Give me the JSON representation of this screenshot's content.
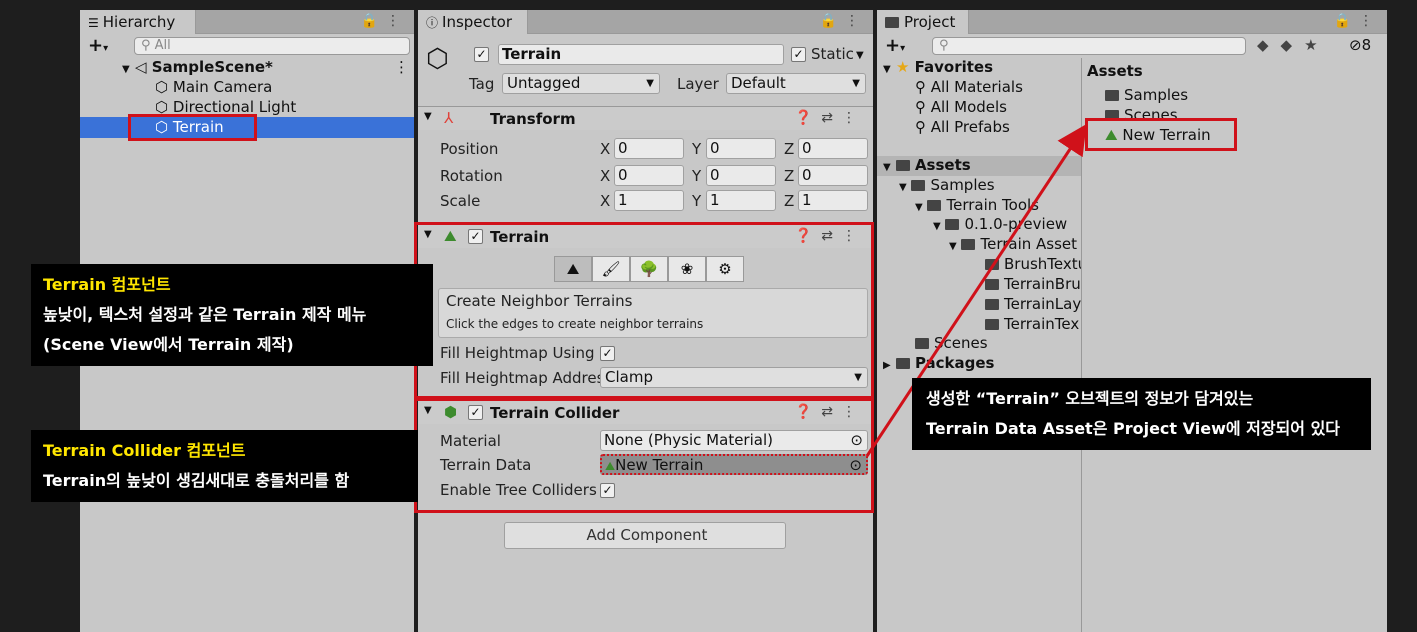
{
  "hierarchy": {
    "tab": "Hierarchy",
    "search_placeholder": "All",
    "scene": "SampleScene*",
    "items": [
      "Main Camera",
      "Directional Light",
      "Terrain"
    ]
  },
  "inspector": {
    "tab": "Inspector",
    "object_name": "Terrain",
    "static_label": "Static",
    "tag_label": "Tag",
    "tag_value": "Untagged",
    "layer_label": "Layer",
    "layer_value": "Default",
    "transform": {
      "title": "Transform",
      "position_label": "Position",
      "rotation_label": "Rotation",
      "scale_label": "Scale",
      "axis_x": "X",
      "axis_y": "Y",
      "axis_z": "Z",
      "position": [
        "0",
        "0",
        "0"
      ],
      "rotation": [
        "0",
        "0",
        "0"
      ],
      "scale": [
        "1",
        "1",
        "1"
      ]
    },
    "terrain": {
      "title": "Terrain",
      "neighbor_title": "Create Neighbor Terrains",
      "neighbor_desc": "Click the edges to create neighbor terrains",
      "fill_heightmap_using": "Fill Heightmap Using I",
      "fill_heightmap_address": "Fill Heightmap Addres",
      "address_value": "Clamp"
    },
    "collider": {
      "title": "Terrain Collider",
      "material_label": "Material",
      "material_value": "None (Physic Material)",
      "data_label": "Terrain Data",
      "data_value": "New Terrain",
      "trees_label": "Enable Tree Colliders"
    },
    "add_component": "Add Component"
  },
  "project": {
    "tab": "Project",
    "hidden_count": "8",
    "favorites": "Favorites",
    "fav_items": [
      "All Materials",
      "All Models",
      "All Prefabs"
    ],
    "assets": "Assets",
    "tree": [
      "Samples",
      "Terrain Tools",
      "0.1.0-preview",
      "Terrain Asset",
      "BrushTextu",
      "TerrainBru",
      "TerrainLay",
      "TerrainTex",
      "Scenes",
      "Packages"
    ],
    "assets_header": "Assets",
    "asset_items": [
      "Samples",
      "Scenes",
      "New Terrain"
    ]
  },
  "callouts": {
    "terrain_title": "Terrain 컴포넌트",
    "terrain_line2": "높낮이, 텍스처 설정과 같은 Terrain 제작 메뉴",
    "terrain_line3": "(Scene View에서 Terrain 제작)",
    "collider_title": "Terrain Collider 컴포넌트",
    "collider_line2": "Terrain의 높낮이 생김새대로 충돌처리를 함",
    "project_line1": "생성한 “Terrain” 오브젝트의 정보가 담겨있는",
    "project_line2": "Terrain Data Asset은 Project View에 저장되어 있다"
  },
  "colors": {
    "highlight_red": "#d0111a",
    "selection_blue": "#3a72d8",
    "callout_yellow": "#ffe600"
  }
}
